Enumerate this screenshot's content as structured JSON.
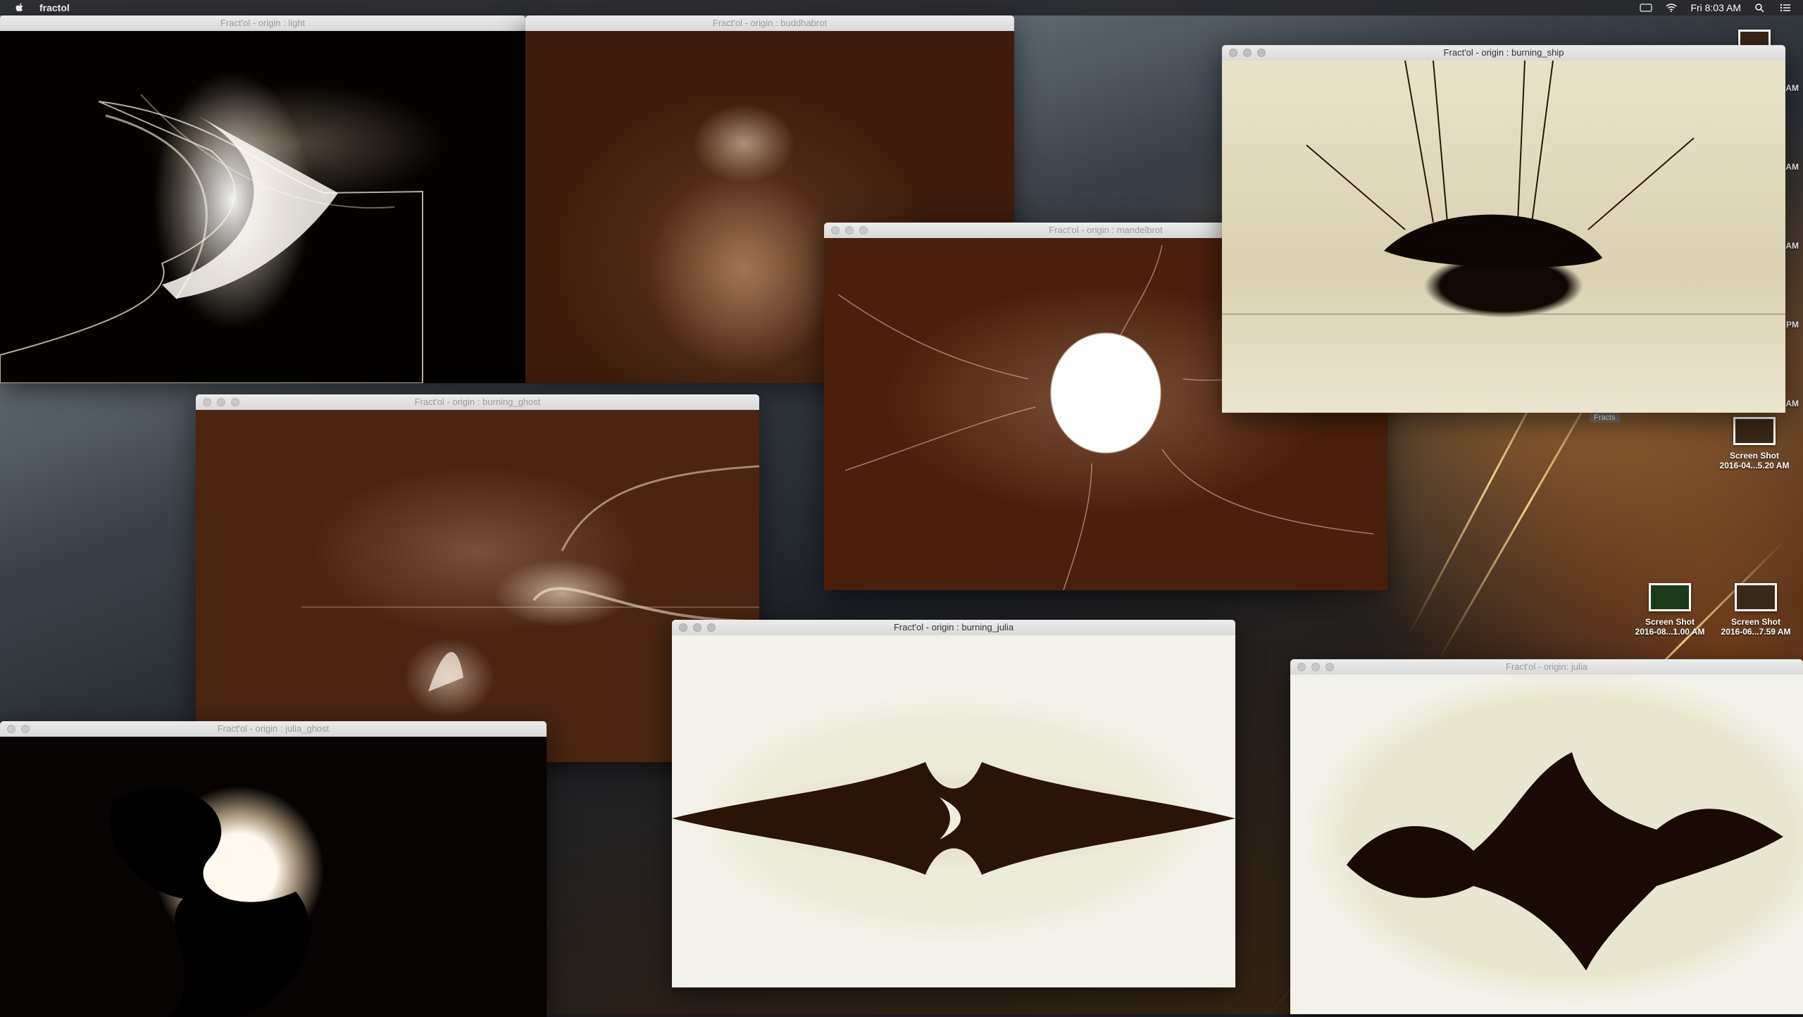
{
  "menubar": {
    "app_name": "fractol",
    "clock": "Fri 8:03 AM"
  },
  "windows": {
    "light": {
      "title": "Fract'ol - origin : light"
    },
    "buddhabrot": {
      "title": "Fract'ol - origin : buddhabrot"
    },
    "mandelbrot": {
      "title": "Fract'ol - origin : mandelbrot"
    },
    "burning_ship": {
      "title": "Fract'ol - origin : burning_ship"
    },
    "burning_ghost": {
      "title": "Fract'ol - origin : burning_ghost"
    },
    "julia_ghost": {
      "title": "Fract'ol - origin : julia_ghost"
    },
    "burning_julia": {
      "title": "Fract'ol - origin : burning_julia"
    },
    "julia": {
      "title": "Fract'ol - origin: julia"
    }
  },
  "desktop": {
    "folder_label": "Fracts",
    "icons": [
      {
        "line1": "Screen Shot",
        "line2": "2016-04...5.20 AM"
      },
      {
        "line1": "Screen Shot",
        "line2": "2016-08...1.00 AM"
      },
      {
        "line1": "Screen Shot",
        "line2": "2016-06...7.59 AM"
      }
    ],
    "edge_labels": [
      "AM",
      "AM",
      "AM",
      "PM",
      "AM"
    ]
  }
}
